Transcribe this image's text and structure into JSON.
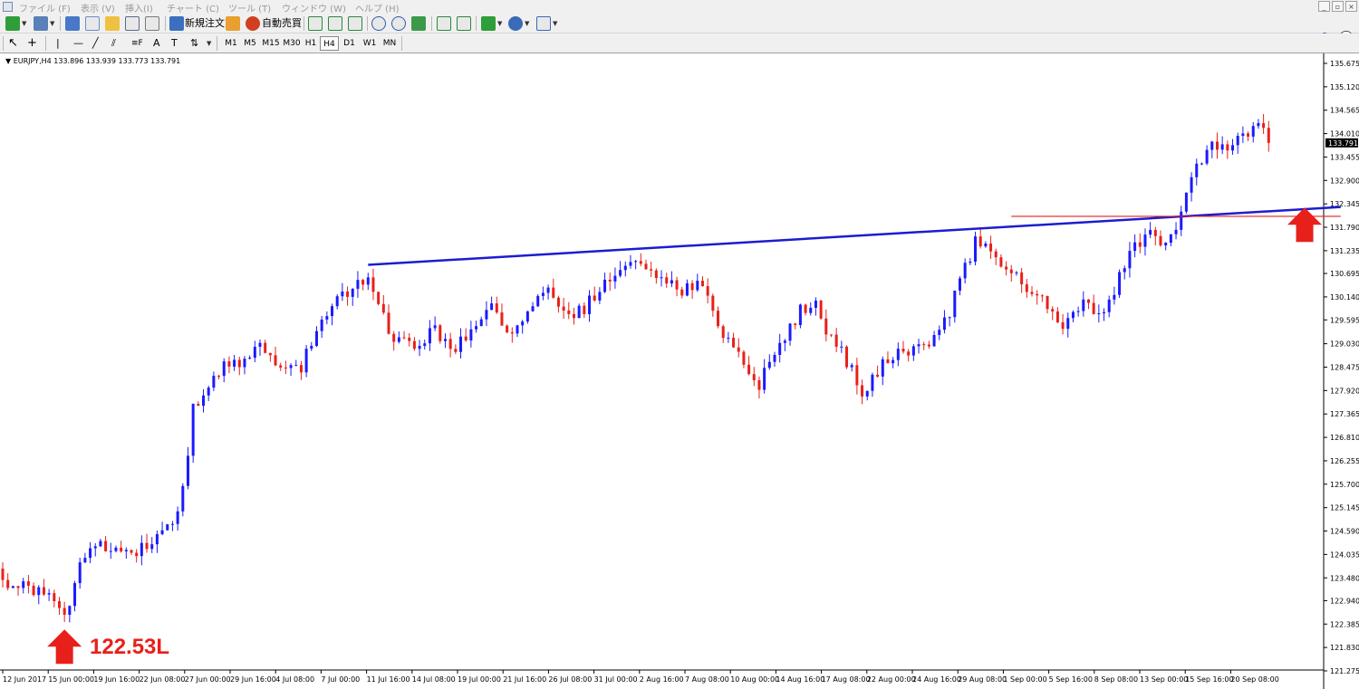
{
  "menu": [
    "ファイル (F)",
    "表示 (V)",
    "挿入(I)",
    "チャート (C)",
    "ツール (T)",
    "ウィンドウ (W)",
    "ヘルプ (H)"
  ],
  "window_buttons": [
    "_",
    "▫",
    "×"
  ],
  "toolbar": {
    "new_order_label": "新規注文",
    "auto_trade_label": "自動売買"
  },
  "timeframes": [
    "M1",
    "M5",
    "M15",
    "M30",
    "H1",
    "H4",
    "D1",
    "W1",
    "MN"
  ],
  "active_timeframe": "H4",
  "chart": {
    "symbol_info": "EURJPY,H4  133.896 133.939 133.773 133.791",
    "current_price": "133.791",
    "annotation": "122.53L"
  },
  "colors": {
    "bull": "#1a1aff",
    "bear": "#e8201a",
    "trendline": "#1c1cd0",
    "hline": "#e02020",
    "arrow": "#e8201a"
  },
  "chart_data": {
    "type": "candlestick",
    "symbol": "EURJPY",
    "timeframe": "H4",
    "y_ticks": [
      135.675,
      135.12,
      134.565,
      134.01,
      133.455,
      132.9,
      132.345,
      131.79,
      131.235,
      130.695,
      130.14,
      129.595,
      129.03,
      128.475,
      127.92,
      127.365,
      126.81,
      126.255,
      125.7,
      125.145,
      124.59,
      124.035,
      123.48,
      122.94,
      122.385,
      121.83,
      121.275
    ],
    "y_range": [
      121.2,
      136.0
    ],
    "x_tick_labels": [
      "12 Jun 2017",
      "15 Jun 00:00",
      "19 Jun 16:00",
      "22 Jun 08:00",
      "27 Jun 00:00",
      "29 Jun 16:00",
      "4 Jul 08:00",
      "7 Jul 00:00",
      "11 Jul 16:00",
      "14 Jul 08:00",
      "19 Jul 00:00",
      "21 Jul 16:00",
      "26 Jul 08:00",
      "31 Jul 00:00",
      "2 Aug 16:00",
      "7 Aug 08:00",
      "10 Aug 00:00",
      "14 Aug 16:00",
      "17 Aug 08:00",
      "22 Aug 00:00",
      "24 Aug 16:00",
      "29 Aug 08:00",
      "1 Sep 00:00",
      "5 Sep 16:00",
      "8 Sep 08:00",
      "13 Sep 00:00",
      "15 Sep 16:00",
      "20 Sep 08:00"
    ],
    "close_path": [
      [
        0,
        123.6
      ],
      [
        2,
        123.2
      ],
      [
        5,
        123.3
      ],
      [
        9,
        123.05
      ],
      [
        12,
        122.6
      ],
      [
        14,
        123.3
      ],
      [
        16,
        124.1
      ],
      [
        20,
        124.25
      ],
      [
        24,
        124.0
      ],
      [
        28,
        124.3
      ],
      [
        30,
        124.5
      ],
      [
        33,
        124.9
      ],
      [
        35,
        125.5
      ],
      [
        37,
        127.5
      ],
      [
        40,
        127.9
      ],
      [
        43,
        128.7
      ],
      [
        46,
        128.5
      ],
      [
        50,
        128.9
      ],
      [
        54,
        128.5
      ],
      [
        58,
        128.4
      ],
      [
        61,
        129.5
      ],
      [
        64,
        129.95
      ],
      [
        67,
        130.3
      ],
      [
        71,
        130.5
      ],
      [
        73,
        129.8
      ],
      [
        76,
        129.2
      ],
      [
        80,
        129.0
      ],
      [
        84,
        129.3
      ],
      [
        88,
        128.9
      ],
      [
        92,
        129.6
      ],
      [
        95,
        130.0
      ],
      [
        99,
        129.2
      ],
      [
        102,
        129.9
      ],
      [
        106,
        130.2
      ],
      [
        110,
        129.6
      ],
      [
        114,
        130.0
      ],
      [
        118,
        130.5
      ],
      [
        121,
        130.9
      ],
      [
        125,
        130.8
      ],
      [
        129,
        130.6
      ],
      [
        132,
        130.3
      ],
      [
        136,
        130.4
      ],
      [
        140,
        129.3
      ],
      [
        144,
        128.5
      ],
      [
        147,
        128.1
      ],
      [
        151,
        129.0
      ],
      [
        155,
        129.8
      ],
      [
        158,
        129.9
      ],
      [
        160,
        129.4
      ],
      [
        164,
        128.6
      ],
      [
        167,
        127.9
      ],
      [
        171,
        128.5
      ],
      [
        175,
        128.9
      ],
      [
        179,
        129.0
      ],
      [
        183,
        129.5
      ],
      [
        186,
        130.5
      ],
      [
        189,
        131.4
      ],
      [
        192,
        131.25
      ],
      [
        196,
        130.7
      ],
      [
        200,
        130.2
      ],
      [
        203,
        130.0
      ],
      [
        206,
        129.5
      ],
      [
        210,
        130.0
      ],
      [
        213,
        129.6
      ],
      [
        216,
        130.3
      ],
      [
        219,
        131.1
      ],
      [
        222,
        131.7
      ],
      [
        225,
        131.3
      ],
      [
        228,
        131.6
      ],
      [
        231,
        132.9
      ],
      [
        235,
        133.8
      ],
      [
        238,
        133.6
      ],
      [
        241,
        133.9
      ],
      [
        244,
        134.35
      ],
      [
        246,
        133.79
      ]
    ],
    "trendline": {
      "from": [
        71,
        130.9
      ],
      "to": [
        260,
        132.27
      ]
    },
    "horizontal_line": {
      "from": [
        196,
        132.05
      ],
      "to": [
        260,
        132.05
      ]
    },
    "arrows": [
      {
        "at": [
          12,
          121.85
        ]
      },
      {
        "at": [
          253,
          131.85
        ]
      }
    ]
  }
}
